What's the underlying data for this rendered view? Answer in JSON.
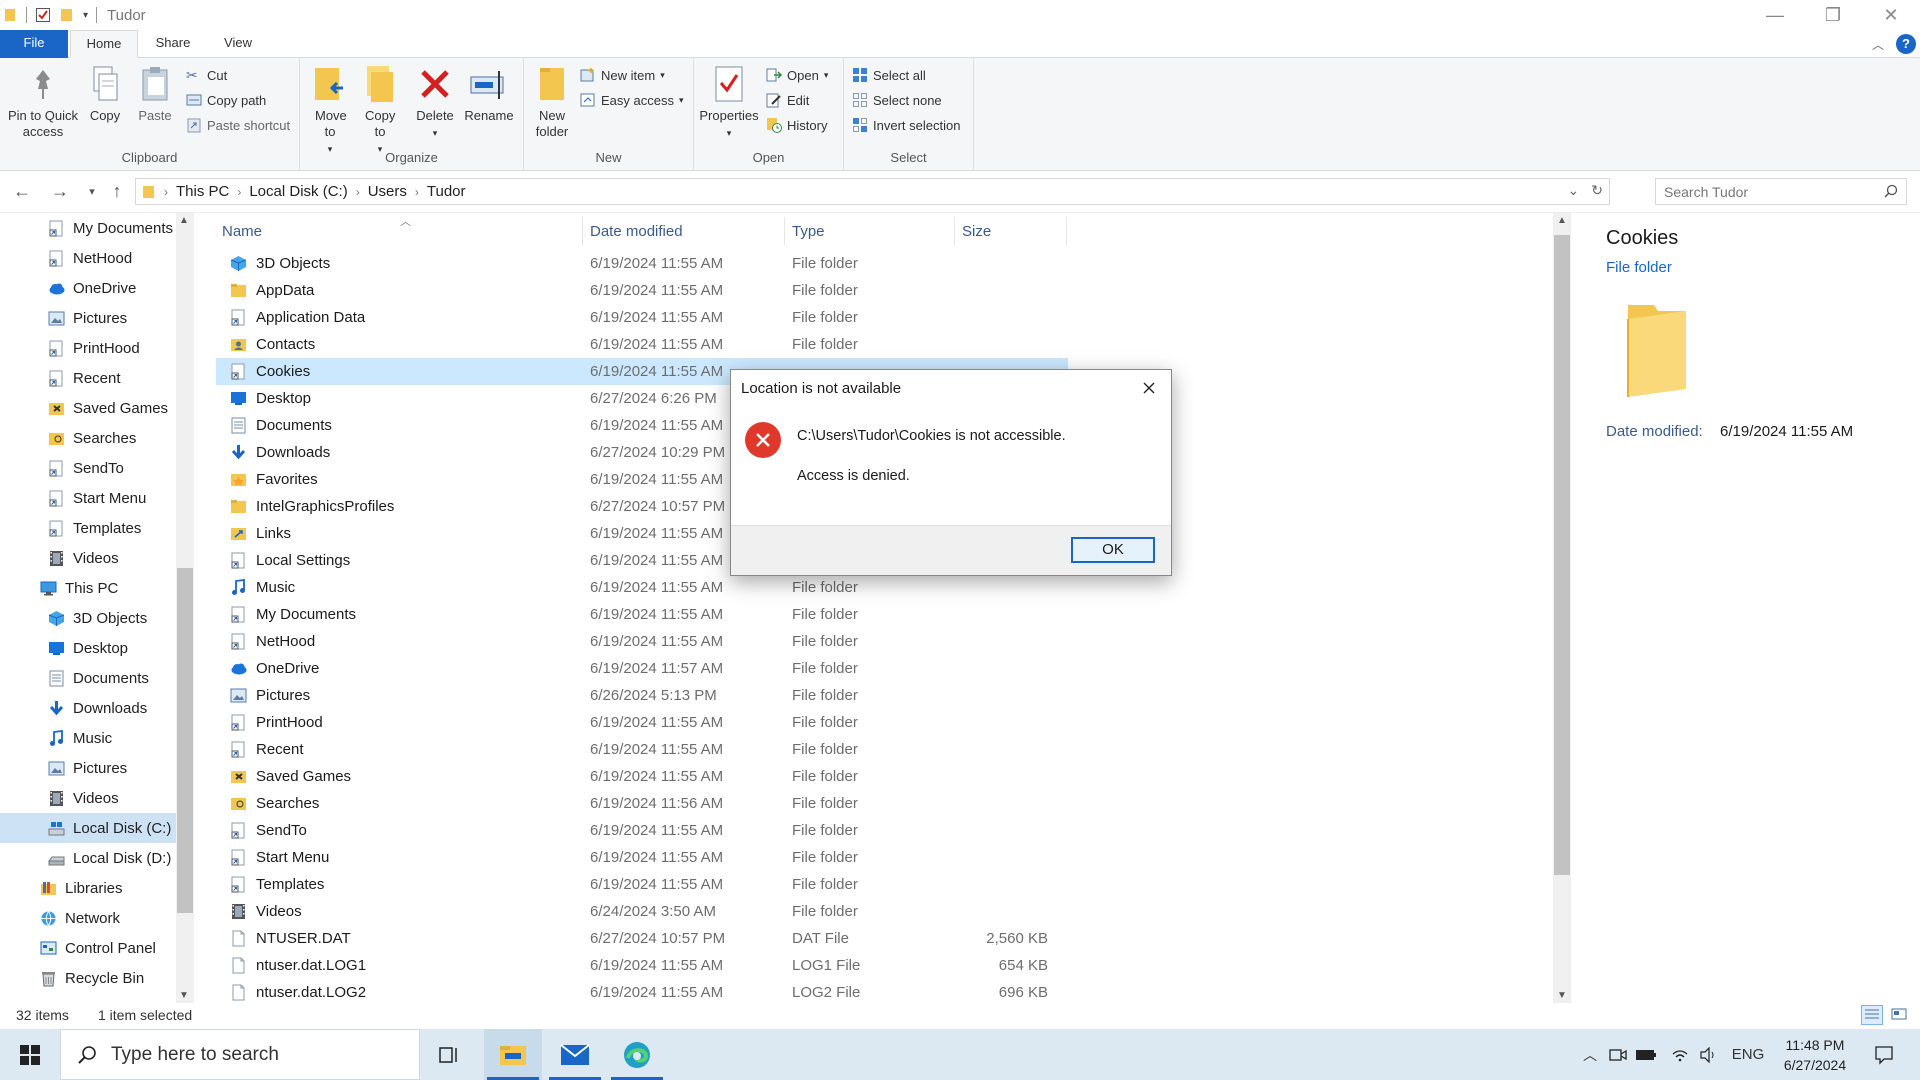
{
  "window": {
    "title": "Tudor"
  },
  "ribbon_tabs": {
    "file": "File",
    "home": "Home",
    "share": "Share",
    "view": "View"
  },
  "ribbon": {
    "clipboard": {
      "label": "Clipboard",
      "pin": "Pin to Quick access",
      "copy": "Copy",
      "paste": "Paste",
      "cut": "Cut",
      "copy_path": "Copy path",
      "paste_shortcut": "Paste shortcut"
    },
    "organize": {
      "label": "Organize",
      "move_to": "Move to",
      "copy_to": "Copy to",
      "delete": "Delete",
      "rename": "Rename"
    },
    "new": {
      "label": "New",
      "new_folder": "New folder",
      "new_item": "New item",
      "easy_access": "Easy access"
    },
    "open": {
      "label": "Open",
      "properties": "Properties",
      "open": "Open",
      "edit": "Edit",
      "history": "History"
    },
    "select": {
      "label": "Select",
      "select_all": "Select all",
      "select_none": "Select none",
      "invert_selection": "Invert selection"
    }
  },
  "address": {
    "crumbs": [
      "This PC",
      "Local Disk (C:)",
      "Users",
      "Tudor"
    ],
    "search_placeholder": "Search Tudor"
  },
  "nav_pane": {
    "items": [
      {
        "label": "My Documents",
        "icon": "shortcut-folder-icon"
      },
      {
        "label": "NetHood",
        "icon": "shortcut-folder-icon"
      },
      {
        "label": "OneDrive",
        "icon": "cloud-icon"
      },
      {
        "label": "Pictures",
        "icon": "pictures-icon"
      },
      {
        "label": "PrintHood",
        "icon": "shortcut-folder-icon"
      },
      {
        "label": "Recent",
        "icon": "shortcut-folder-icon"
      },
      {
        "label": "Saved Games",
        "icon": "saved-games-icon"
      },
      {
        "label": "Searches",
        "icon": "searches-icon"
      },
      {
        "label": "SendTo",
        "icon": "shortcut-folder-icon"
      },
      {
        "label": "Start Menu",
        "icon": "shortcut-folder-icon"
      },
      {
        "label": "Templates",
        "icon": "shortcut-folder-icon"
      },
      {
        "label": "Videos",
        "icon": "videos-icon"
      },
      {
        "label": "This PC",
        "icon": "pc-icon"
      },
      {
        "label": "3D Objects",
        "icon": "3d-objects-icon"
      },
      {
        "label": "Desktop",
        "icon": "desktop-icon"
      },
      {
        "label": "Documents",
        "icon": "documents-icon"
      },
      {
        "label": "Downloads",
        "icon": "downloads-icon"
      },
      {
        "label": "Music",
        "icon": "music-icon"
      },
      {
        "label": "Pictures",
        "icon": "pictures-icon"
      },
      {
        "label": "Videos",
        "icon": "videos-icon"
      },
      {
        "label": "Local Disk (C:)",
        "icon": "drive-c-icon"
      },
      {
        "label": "Local Disk (D:)",
        "icon": "drive-icon"
      },
      {
        "label": "Libraries",
        "icon": "libraries-icon"
      },
      {
        "label": "Network",
        "icon": "network-icon"
      },
      {
        "label": "Control Panel",
        "icon": "control-panel-icon"
      },
      {
        "label": "Recycle Bin",
        "icon": "recycle-bin-icon"
      }
    ]
  },
  "columns": {
    "name": "Name",
    "date": "Date modified",
    "type": "Type",
    "size": "Size"
  },
  "files": [
    {
      "name": "3D Objects",
      "date": "6/19/2024 11:55 AM",
      "type": "File folder",
      "size": "",
      "icon": "3d-objects-icon"
    },
    {
      "name": "AppData",
      "date": "6/19/2024 11:55 AM",
      "type": "File folder",
      "size": "",
      "icon": "folder-icon"
    },
    {
      "name": "Application Data",
      "date": "6/19/2024 11:55 AM",
      "type": "File folder",
      "size": "",
      "icon": "shortcut-folder-icon"
    },
    {
      "name": "Contacts",
      "date": "6/19/2024 11:55 AM",
      "type": "File folder",
      "size": "",
      "icon": "contacts-icon"
    },
    {
      "name": "Cookies",
      "date": "6/19/2024 11:55 AM",
      "type": "",
      "size": "",
      "icon": "shortcut-folder-icon"
    },
    {
      "name": "Desktop",
      "date": "6/27/2024 6:26 PM",
      "type": "",
      "size": "",
      "icon": "desktop-icon"
    },
    {
      "name": "Documents",
      "date": "6/19/2024 11:55 AM",
      "type": "",
      "size": "",
      "icon": "documents-icon"
    },
    {
      "name": "Downloads",
      "date": "6/27/2024 10:29 PM",
      "type": "",
      "size": "",
      "icon": "downloads-icon"
    },
    {
      "name": "Favorites",
      "date": "6/19/2024 11:55 AM",
      "type": "",
      "size": "",
      "icon": "favorites-icon"
    },
    {
      "name": "IntelGraphicsProfiles",
      "date": "6/27/2024 10:57 PM",
      "type": "",
      "size": "",
      "icon": "folder-icon"
    },
    {
      "name": "Links",
      "date": "6/19/2024 11:55 AM",
      "type": "",
      "size": "",
      "icon": "links-icon"
    },
    {
      "name": "Local Settings",
      "date": "6/19/2024 11:55 AM",
      "type": "",
      "size": "",
      "icon": "shortcut-folder-icon"
    },
    {
      "name": "Music",
      "date": "6/19/2024 11:55 AM",
      "type": "File folder",
      "size": "",
      "icon": "music-icon"
    },
    {
      "name": "My Documents",
      "date": "6/19/2024 11:55 AM",
      "type": "File folder",
      "size": "",
      "icon": "shortcut-folder-icon"
    },
    {
      "name": "NetHood",
      "date": "6/19/2024 11:55 AM",
      "type": "File folder",
      "size": "",
      "icon": "shortcut-folder-icon"
    },
    {
      "name": "OneDrive",
      "date": "6/19/2024 11:57 AM",
      "type": "File folder",
      "size": "",
      "icon": "cloud-icon"
    },
    {
      "name": "Pictures",
      "date": "6/26/2024 5:13 PM",
      "type": "File folder",
      "size": "",
      "icon": "pictures-icon"
    },
    {
      "name": "PrintHood",
      "date": "6/19/2024 11:55 AM",
      "type": "File folder",
      "size": "",
      "icon": "shortcut-folder-icon"
    },
    {
      "name": "Recent",
      "date": "6/19/2024 11:55 AM",
      "type": "File folder",
      "size": "",
      "icon": "shortcut-folder-icon"
    },
    {
      "name": "Saved Games",
      "date": "6/19/2024 11:55 AM",
      "type": "File folder",
      "size": "",
      "icon": "saved-games-icon"
    },
    {
      "name": "Searches",
      "date": "6/19/2024 11:56 AM",
      "type": "File folder",
      "size": "",
      "icon": "searches-icon"
    },
    {
      "name": "SendTo",
      "date": "6/19/2024 11:55 AM",
      "type": "File folder",
      "size": "",
      "icon": "shortcut-folder-icon"
    },
    {
      "name": "Start Menu",
      "date": "6/19/2024 11:55 AM",
      "type": "File folder",
      "size": "",
      "icon": "shortcut-folder-icon"
    },
    {
      "name": "Templates",
      "date": "6/19/2024 11:55 AM",
      "type": "File folder",
      "size": "",
      "icon": "shortcut-folder-icon"
    },
    {
      "name": "Videos",
      "date": "6/24/2024 3:50 AM",
      "type": "File folder",
      "size": "",
      "icon": "videos-icon"
    },
    {
      "name": "NTUSER.DAT",
      "date": "6/27/2024 10:57 PM",
      "type": "DAT File",
      "size": "2,560 KB",
      "icon": "file-icon"
    },
    {
      "name": "ntuser.dat.LOG1",
      "date": "6/19/2024 11:55 AM",
      "type": "LOG1 File",
      "size": "654 KB",
      "icon": "file-icon"
    },
    {
      "name": "ntuser.dat.LOG2",
      "date": "6/19/2024 11:55 AM",
      "type": "LOG2 File",
      "size": "696 KB",
      "icon": "file-icon"
    }
  ],
  "preview": {
    "title": "Cookies",
    "type": "File folder",
    "date_label": "Date modified:",
    "date_value": "6/19/2024 11:55 AM"
  },
  "status": {
    "count": "32 items",
    "selected": "1 item selected"
  },
  "dialog": {
    "title": "Location is not available",
    "message": "C:\\Users\\Tudor\\Cookies is not accessible.",
    "detail": "Access is denied.",
    "ok": "OK"
  },
  "taskbar": {
    "search_placeholder": "Type here to search",
    "language": "ENG",
    "time": "11:48 PM",
    "date": "6/27/2024"
  },
  "colors": {
    "accent": "#1a66c6",
    "selection": "#cce8ff",
    "error": "#e0392b",
    "folder": "#f3c74f"
  }
}
